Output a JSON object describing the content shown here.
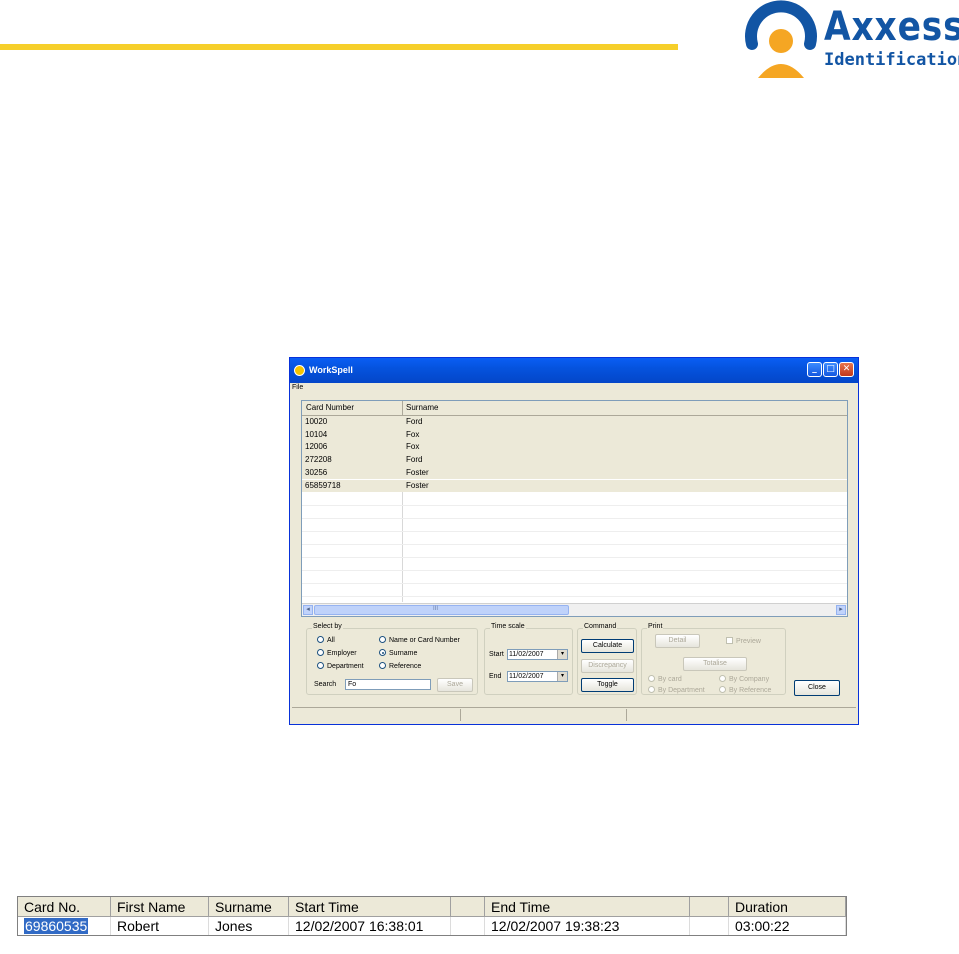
{
  "logo": {
    "brand": "Axxess",
    "sub": "Identification"
  },
  "window": {
    "title": "WorkSpell",
    "menu": [
      "File"
    ],
    "controls": {
      "minimize": "_",
      "maximize": "□",
      "close": "✕"
    },
    "list": {
      "columns": [
        "Card Number",
        "Surname"
      ],
      "rows": [
        [
          "10020",
          "Ford"
        ],
        [
          "10104",
          "Fox"
        ],
        [
          "12006",
          "Fox"
        ],
        [
          "272208",
          "Ford"
        ],
        [
          "30256",
          "Foster"
        ],
        [
          "65859718",
          "Foster"
        ]
      ],
      "scroll_thumb": "III"
    },
    "select_by": {
      "legend": "Select by",
      "options": [
        "All",
        "Name or Card Number",
        "Employer",
        "Surname",
        "Department",
        "Reference"
      ],
      "selected": "Surname",
      "search_label": "Search",
      "search_value": "Fo",
      "save_label": "Save"
    },
    "time_scale": {
      "legend": "Time scale",
      "start_label": "Start",
      "start_value": "11/02/2007",
      "end_label": "End",
      "end_value": "11/02/2007"
    },
    "command": {
      "legend": "Command",
      "calculate": "Calculate",
      "discrepancy": "Discrepancy",
      "toggle": "Toggle"
    },
    "print": {
      "legend": "Print",
      "detail": "Detail",
      "preview": "Preview",
      "totalise": "Totalise",
      "options": [
        "By card",
        "By Company",
        "By Department",
        "By Reference"
      ]
    },
    "close_label": "Close"
  },
  "result_table": {
    "columns": [
      "Card No.",
      "First Name",
      "Surname",
      "Start Time",
      "",
      "End Time",
      "",
      "Duration"
    ],
    "row": [
      "69860535",
      "Robert",
      "Jones",
      "12/02/2007 16:38:01",
      "",
      "12/02/2007 19:38:23",
      "",
      "03:00:22"
    ]
  },
  "colors": {
    "accent_yellow": "#f6cf2a",
    "brand_blue": "#1255a4",
    "xp_title": "#0553de",
    "selection": "#316ac5"
  }
}
